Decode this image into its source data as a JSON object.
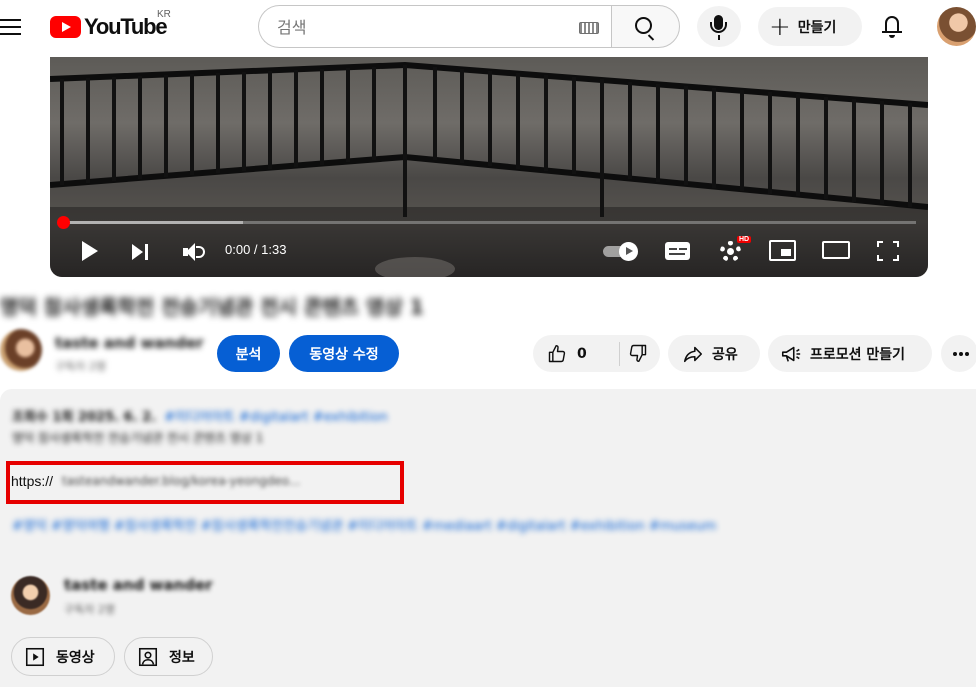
{
  "masthead": {
    "logo_text": "YouTube",
    "region": "KR",
    "search_placeholder": "검색",
    "create_label": "만들기"
  },
  "player": {
    "time": "0:00 / 1:33",
    "progress": 0.0,
    "buffered": 0.21,
    "hd_badge": "HD"
  },
  "video": {
    "title": "명덕 참사생록학전 전승기념관 전시 콘텐츠 영상 1",
    "channel_name": "taste and wander",
    "subscribers": "구독자 2명",
    "analytics_label": "분석",
    "edit_label": "동영상 수정",
    "like_count": "0",
    "share_label": "공유",
    "promote_label": "프로모션 만들기"
  },
  "description": {
    "meta": "조회수 1회  2025. 6. 2.",
    "meta_tags": "#미디어아트 #digitalart #exhibition",
    "line1": "명덕 참사생록학전 전승기념관 전시 콘텐츠 영상 1",
    "link_prefix": "https://",
    "link_rest": "tasteandwander.blog/korea-yeongdeo...",
    "hashtags": "#영덕 #영덕여행 #참사생록학전 #참사생록학전전승기념관 #미디어아트 #mediaart #digitalart #exhibition #museum",
    "channel_name": "taste and wander",
    "subscribers": "구독자 2명",
    "videos_label": "동영상",
    "about_label": "정보"
  },
  "colors": {
    "brand_red": "#ff0000",
    "accent_blue": "#065fd4",
    "highlight_frame": "#e60000",
    "chip_bg": "#f2f2f2"
  }
}
